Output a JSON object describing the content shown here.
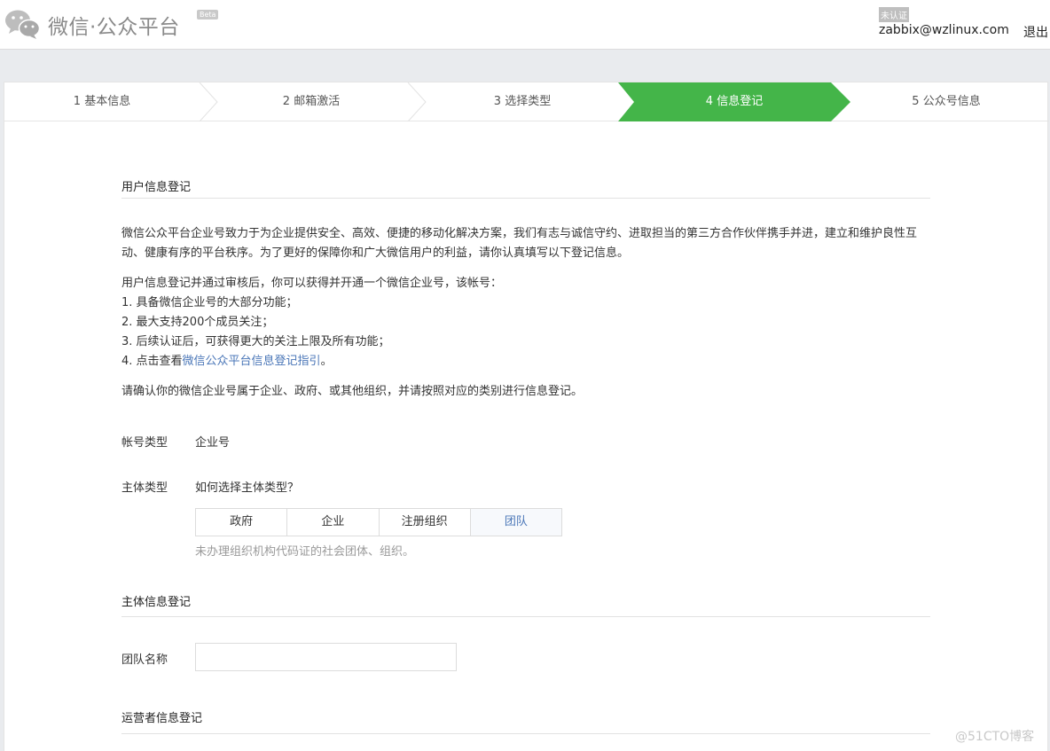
{
  "header": {
    "brand": "微信·公众平台",
    "beta": "Beta",
    "status_badge": "未认证",
    "account": "zabbix@wzlinux.com",
    "logout": "退出",
    "logo_icon": "wechat-icon"
  },
  "steps": [
    {
      "label": "1 基本信息",
      "active": false
    },
    {
      "label": "2 邮箱激活",
      "active": false
    },
    {
      "label": "3 选择类型",
      "active": false
    },
    {
      "label": "4 信息登记",
      "active": true
    },
    {
      "label": "5 公众号信息",
      "active": false
    }
  ],
  "colors": {
    "active_step": "#44b549",
    "link": "#4b77b8"
  },
  "user_section": {
    "title": "用户信息登记",
    "intro": "微信公众平台企业号致力于为企业提供安全、高效、便捷的移动化解决方案，我们有志与诚信守约、进取担当的第三方合作伙伴携手并进，建立和维护良性互动、健康有序的平台秩序。为了更好的保障你和广大微信用户的利益，请你认真填写以下登记信息。",
    "benefits_intro": "用户信息登记并通过审核后，你可以获得并开通一个微信企业号，该帐号：",
    "benefit_1": "1. 具备微信企业号的大部分功能；",
    "benefit_2": "2. 最大支持200个成员关注；",
    "benefit_3": "3. 后续认证后，可获得更大的关注上限及所有功能；",
    "benefit_4_prefix": "4. 点击查看",
    "benefit_4_link": "微信公众平台信息登记指引",
    "benefit_4_suffix": "。",
    "confirm_text": "请确认你的微信企业号属于企业、政府、或其他组织，并请按照对应的类别进行信息登记。"
  },
  "account_type": {
    "label": "帐号类型",
    "value": "企业号"
  },
  "subject_type": {
    "label": "主体类型",
    "help_link": "如何选择主体类型？",
    "options": [
      "政府",
      "企业",
      "注册组织",
      "团队"
    ],
    "selected": "团队",
    "hint": "未办理组织机构代码证的社会团体、组织。"
  },
  "subject_section": {
    "title": "主体信息登记",
    "team_name_label": "团队名称",
    "team_name_value": ""
  },
  "operator_section": {
    "title": "运营者信息登记"
  },
  "watermark": "@51CTO博客"
}
